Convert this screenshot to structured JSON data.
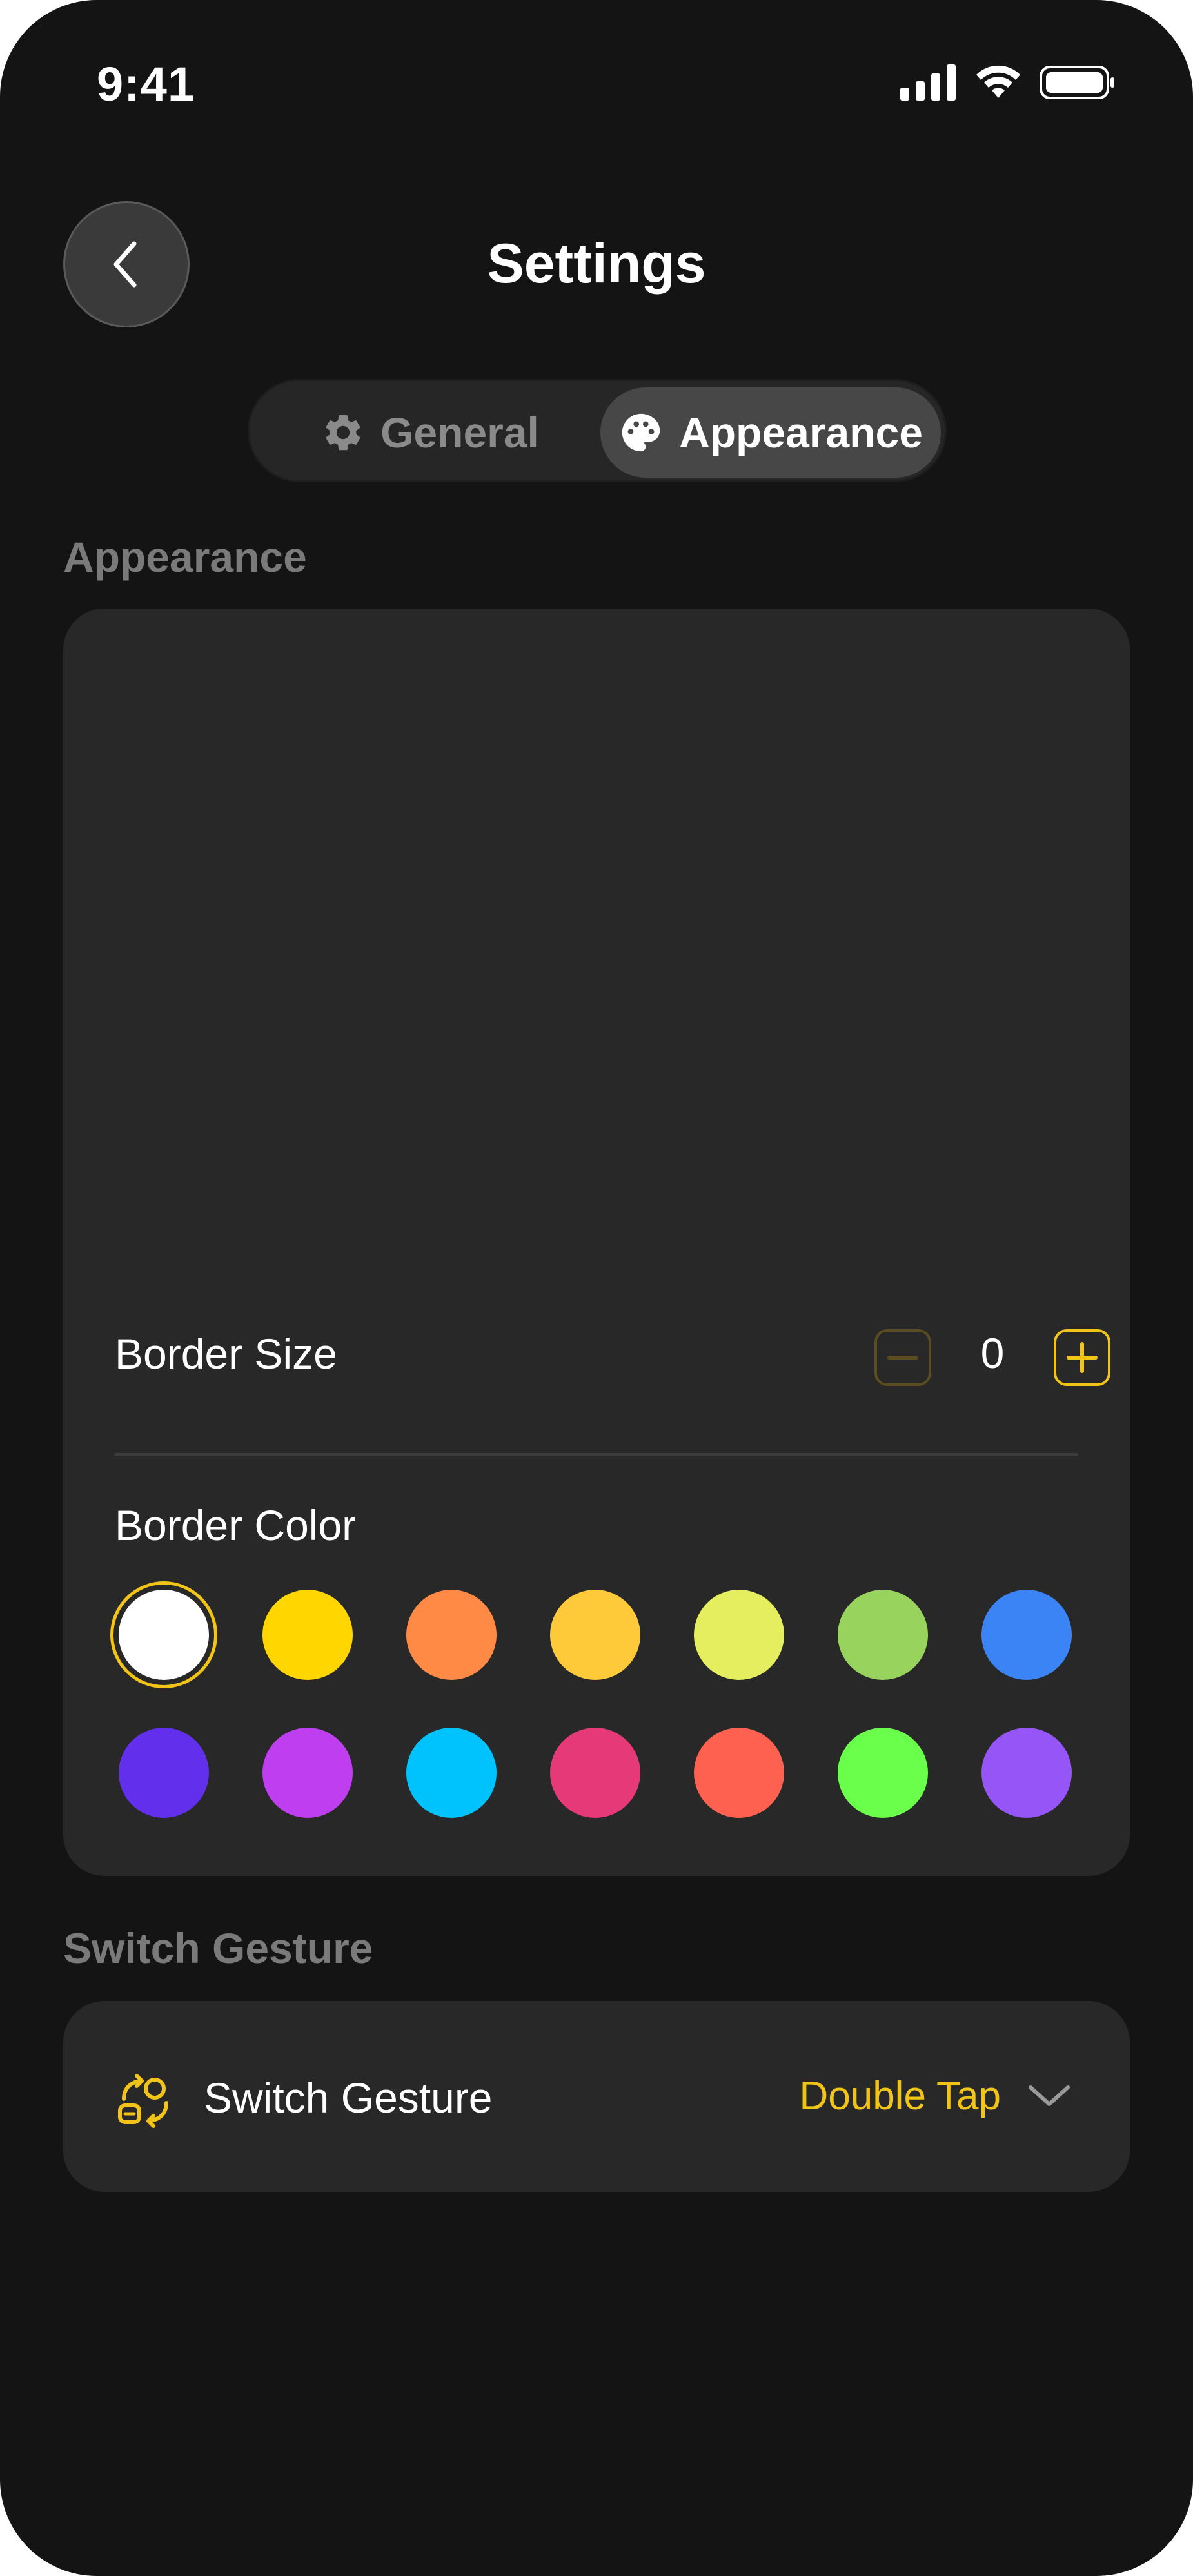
{
  "status_bar": {
    "time": "9:41"
  },
  "header": {
    "title": "Settings",
    "back_icon": "chevron-left-icon"
  },
  "tabs": [
    {
      "label": "General",
      "icon": "gear-icon",
      "selected": false
    },
    {
      "label": "Appearance",
      "icon": "palette-icon",
      "selected": true
    }
  ],
  "appearance_section": {
    "label": "Appearance",
    "border_size": {
      "label": "Border Size",
      "value": "0"
    },
    "border_color": {
      "label": "Border Color",
      "selected_index": 0,
      "colors": [
        "#ffffff",
        "#ffd600",
        "#ff8a46",
        "#ffca3a",
        "#e5ee5e",
        "#98d35e",
        "#3b84f5",
        "#6230ec",
        "#bf3ef0",
        "#00c3fd",
        "#e63a78",
        "#ff6150",
        "#6aff4a",
        "#9655f6"
      ]
    }
  },
  "gesture_section": {
    "label": "Switch Gesture",
    "row_label": "Switch Gesture",
    "value": "Double Tap",
    "icon": "gesture-switch-icon"
  },
  "accent_color": "#f2c417"
}
